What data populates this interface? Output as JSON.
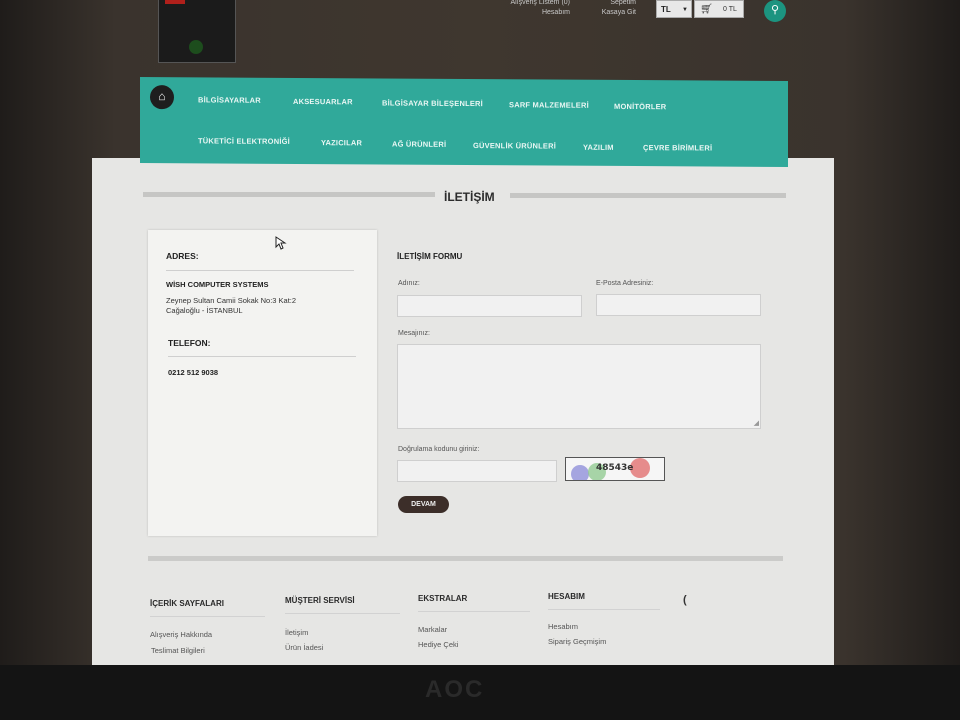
{
  "header": {
    "top_links": [
      [
        "Alışveriş Listem (0)",
        "Hesabım"
      ],
      [
        "Sepetim",
        "Kasaya Git"
      ]
    ],
    "currency": "TL",
    "cart_total": "0 TL"
  },
  "nav": {
    "items": [
      "BİLGİSAYARLAR",
      "AKSESUARLAR",
      "BİLGİSAYAR BİLEŞENLERİ",
      "SARF MALZEMELERİ",
      "MONİTÖRLER",
      "TÜKETİCİ ELEKTRONİĞİ",
      "YAZICILAR",
      "AĞ ÜRÜNLERİ",
      "GÜVENLİK ÜRÜNLERİ",
      "YAZILIM",
      "ÇEVRE BİRİMLERİ"
    ]
  },
  "page": {
    "title": "İLETİŞİM"
  },
  "address": {
    "label": "ADRES:",
    "company": "WİSH COMPUTER SYSTEMS",
    "lines": [
      "Zeynep Sultan Camii Sokak No:3 Kat:2",
      "Cağaloğlu - İSTANBUL"
    ],
    "phone_label": "TELEFON:",
    "phone": "0212 512 9038"
  },
  "form": {
    "title": "İLETİŞİM FORMU",
    "name_label": "Adınız:",
    "email_label": "E-Posta Adresiniz:",
    "message_label": "Mesajınız:",
    "captcha_label": "Doğrulama kodunu giriniz:",
    "captcha_code": "48543e",
    "submit": "DEVAM"
  },
  "footer": {
    "columns": [
      {
        "title": "İÇERİK SAYFALARI",
        "links": [
          "Alışveriş Hakkında",
          "Teslimat Bilgileri"
        ]
      },
      {
        "title": "MÜŞTERİ SERVİSİ",
        "links": [
          "İletişim",
          "Ürün İadesi"
        ]
      },
      {
        "title": "EKSTRALAR",
        "links": [
          "Markalar",
          "Hediye Çeki"
        ]
      },
      {
        "title": "HESABIM",
        "links": [
          "Hesabım",
          "Sipariş Geçmişim"
        ]
      }
    ]
  },
  "monitor": {
    "brand": "AOC"
  },
  "icons": [
    "home-icon",
    "cart-icon",
    "search-icon",
    "phone-icon",
    "cursor-icon",
    "chevron-down-icon"
  ],
  "colors": {
    "nav_bg": "#30a99a",
    "search_btn": "#1c9480",
    "submit_btn": "#3c2e29"
  }
}
